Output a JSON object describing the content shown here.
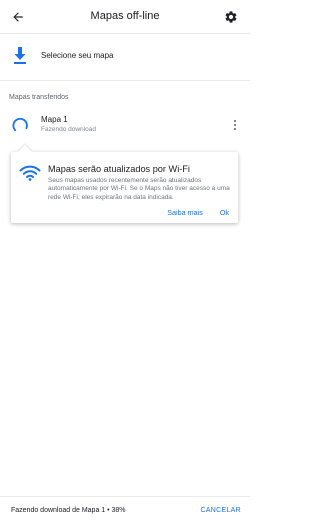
{
  "header": {
    "title": "Mapas off-line",
    "back_icon": "arrow-back-icon",
    "settings_icon": "gear-icon"
  },
  "select_map": {
    "label": "Selecione seu mapa",
    "icon": "download-icon"
  },
  "section": {
    "title": "Mapas transferidos"
  },
  "maps": [
    {
      "name": "Mapa 1",
      "status": "Fazendo download",
      "icon": "loading-spinner-icon",
      "menu_icon": "more-vert-icon"
    }
  ],
  "tooltip": {
    "icon": "wifi-icon",
    "title": "Mapas serão atualizados por Wi-Fi",
    "body": "Seus mapas usados recentemente serão atualizados automaticamente por Wi-Fi. Se o Maps não tiver acesso a uma rede Wi-Fi, eles expirarão na data indicada.",
    "learn_more": "Saiba mais",
    "ok": "Ok"
  },
  "bottom": {
    "progress_text": "Fazendo download de Mapa 1 • 38%",
    "progress_percent": 38,
    "cancel": "CANCELAR"
  },
  "colors": {
    "accent": "#1a73e8",
    "text_primary": "#202124",
    "text_secondary": "#5f6368"
  }
}
